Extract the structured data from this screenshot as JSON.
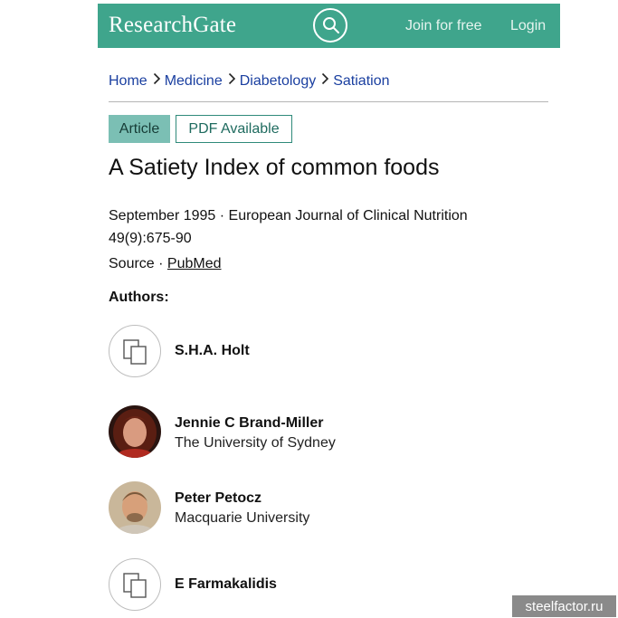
{
  "header": {
    "logo": "ResearchGate",
    "search_icon": "search-icon",
    "join_label": "Join for free",
    "login_label": "Login",
    "brand_color": "#3fa58c"
  },
  "breadcrumb": [
    "Home",
    "Medicine",
    "Diabetology",
    "Satiation"
  ],
  "badges": {
    "article": "Article",
    "pdf": "PDF Available"
  },
  "title": "A Satiety Index of common foods",
  "meta": {
    "date_journal": "September 1995 · European Journal of Clinical Nutrition",
    "volume": "49(9):675-90",
    "source_prefix": "Source · ",
    "source_link": "PubMed"
  },
  "authors_label": "Authors:",
  "authors": [
    {
      "name": "S.H.A. Holt",
      "institution": "",
      "avatar": "placeholder-icon"
    },
    {
      "name": "Jennie C Brand-Miller",
      "institution": "The University of Sydney",
      "avatar": "photo"
    },
    {
      "name": "Peter Petocz",
      "institution": "Macquarie University",
      "avatar": "photo"
    },
    {
      "name": "E Farmakalidis",
      "institution": "",
      "avatar": "placeholder-icon"
    }
  ],
  "watermark": "steelfactor.ru"
}
